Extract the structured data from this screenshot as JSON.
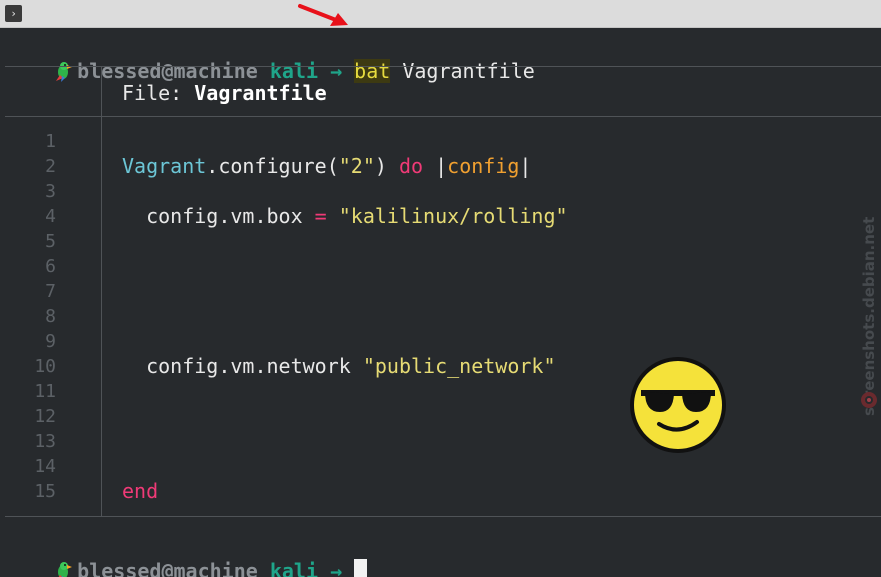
{
  "prompt": {
    "user": "blessed@machine",
    "directory": "kali",
    "arrow": "→",
    "command": "bat",
    "argument": "Vagrantfile"
  },
  "file_header": {
    "label": "File:",
    "filename": "Vagrantfile"
  },
  "line_numbers": [
    "1",
    "2",
    "3",
    "4",
    "5",
    "6",
    "7",
    "8",
    "9",
    "10",
    "11",
    "12",
    "13",
    "14",
    "15"
  ],
  "code": {
    "line2": {
      "const": "Vagrant",
      "method": ".configure(",
      "str": "\"2\"",
      "close": ") ",
      "kw": "do",
      "pipe1": " |",
      "param": "config",
      "pipe2": "|"
    },
    "line4": {
      "indent": "  ",
      "text": "config.vm.box ",
      "op": "=",
      "space": " ",
      "str": "\"kalilinux/rolling\""
    },
    "line10": {
      "indent": "  ",
      "text": "config.vm.network ",
      "str": "\"public_network\""
    },
    "line15": {
      "kw": "end"
    }
  },
  "watermark": "screenshots.debian.net",
  "icons": {
    "terminal": "terminal-icon",
    "parrot": "parrot-icon",
    "emoji": "sunglasses-emoji-icon",
    "arrow": "red-arrow-icon"
  },
  "colors": {
    "background": "#272a2d",
    "accent_green": "#1fa58a",
    "string": "#e6db74",
    "keyword": "#f03a77",
    "constant": "#6cc6d6",
    "param": "#f0a030"
  }
}
